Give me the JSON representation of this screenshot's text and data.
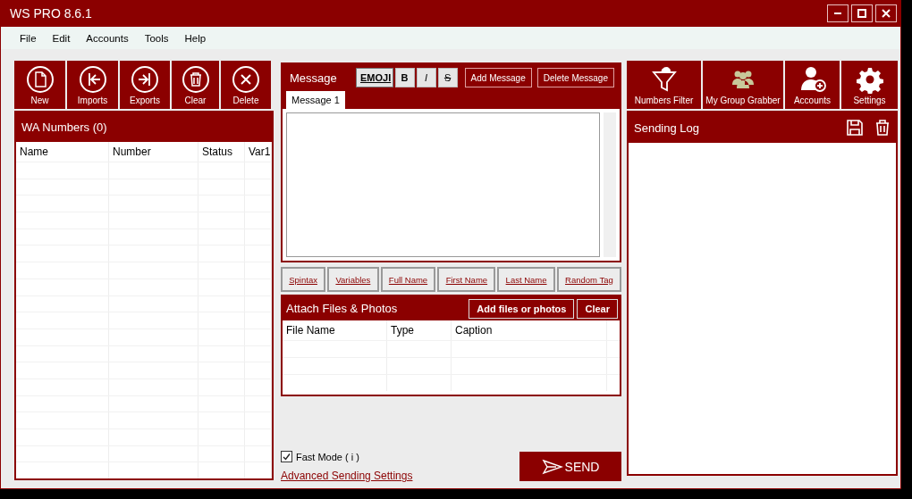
{
  "window": {
    "title": "WS PRO 8.6.1"
  },
  "menu": [
    "File",
    "Edit",
    "Accounts",
    "Tools",
    "Help"
  ],
  "left_toolbar": [
    {
      "label": "New",
      "kind": "file"
    },
    {
      "label": "Imports",
      "kind": "import"
    },
    {
      "label": "Exports",
      "kind": "export"
    },
    {
      "label": "Clear",
      "kind": "trash"
    },
    {
      "label": "Delete",
      "kind": "close"
    }
  ],
  "numbers_panel": {
    "title": "WA Numbers (0)",
    "columns": [
      "Name",
      "Number",
      "Status",
      "Var1"
    ]
  },
  "message": {
    "title": "Message",
    "format_buttons": [
      {
        "label": "EMOJI",
        "kind": "emoji"
      },
      {
        "label": "B",
        "kind": "bold"
      },
      {
        "label": "I",
        "kind": "italic"
      },
      {
        "label": "S",
        "kind": "strike"
      }
    ],
    "actions": [
      "Add Message",
      "Delete Message"
    ],
    "tabs": [
      {
        "label": "Message 1",
        "selected": true
      }
    ],
    "variable_buttons": [
      "Spintax",
      "Variables",
      "Full Name",
      "First Name",
      "Last Name",
      "Random Tag"
    ]
  },
  "attachments": {
    "title": "Attach Files & Photos",
    "buttons": [
      "Add files or photos",
      "Clear"
    ],
    "columns": [
      "File Name",
      "Type",
      "Caption"
    ]
  },
  "fast_mode": {
    "label": "Fast Mode ( i )",
    "checked": true
  },
  "advanced_link": "Advanced Sending Settings",
  "send_button": "SEND",
  "right_toolbar": [
    {
      "label": "Numbers Filter",
      "kind": "filter"
    },
    {
      "label": "My Group Grabber",
      "kind": "group"
    },
    {
      "label": "Accounts",
      "kind": "account"
    },
    {
      "label": "Settings",
      "kind": "gear"
    }
  ],
  "log_panel": {
    "title": "Sending Log"
  }
}
